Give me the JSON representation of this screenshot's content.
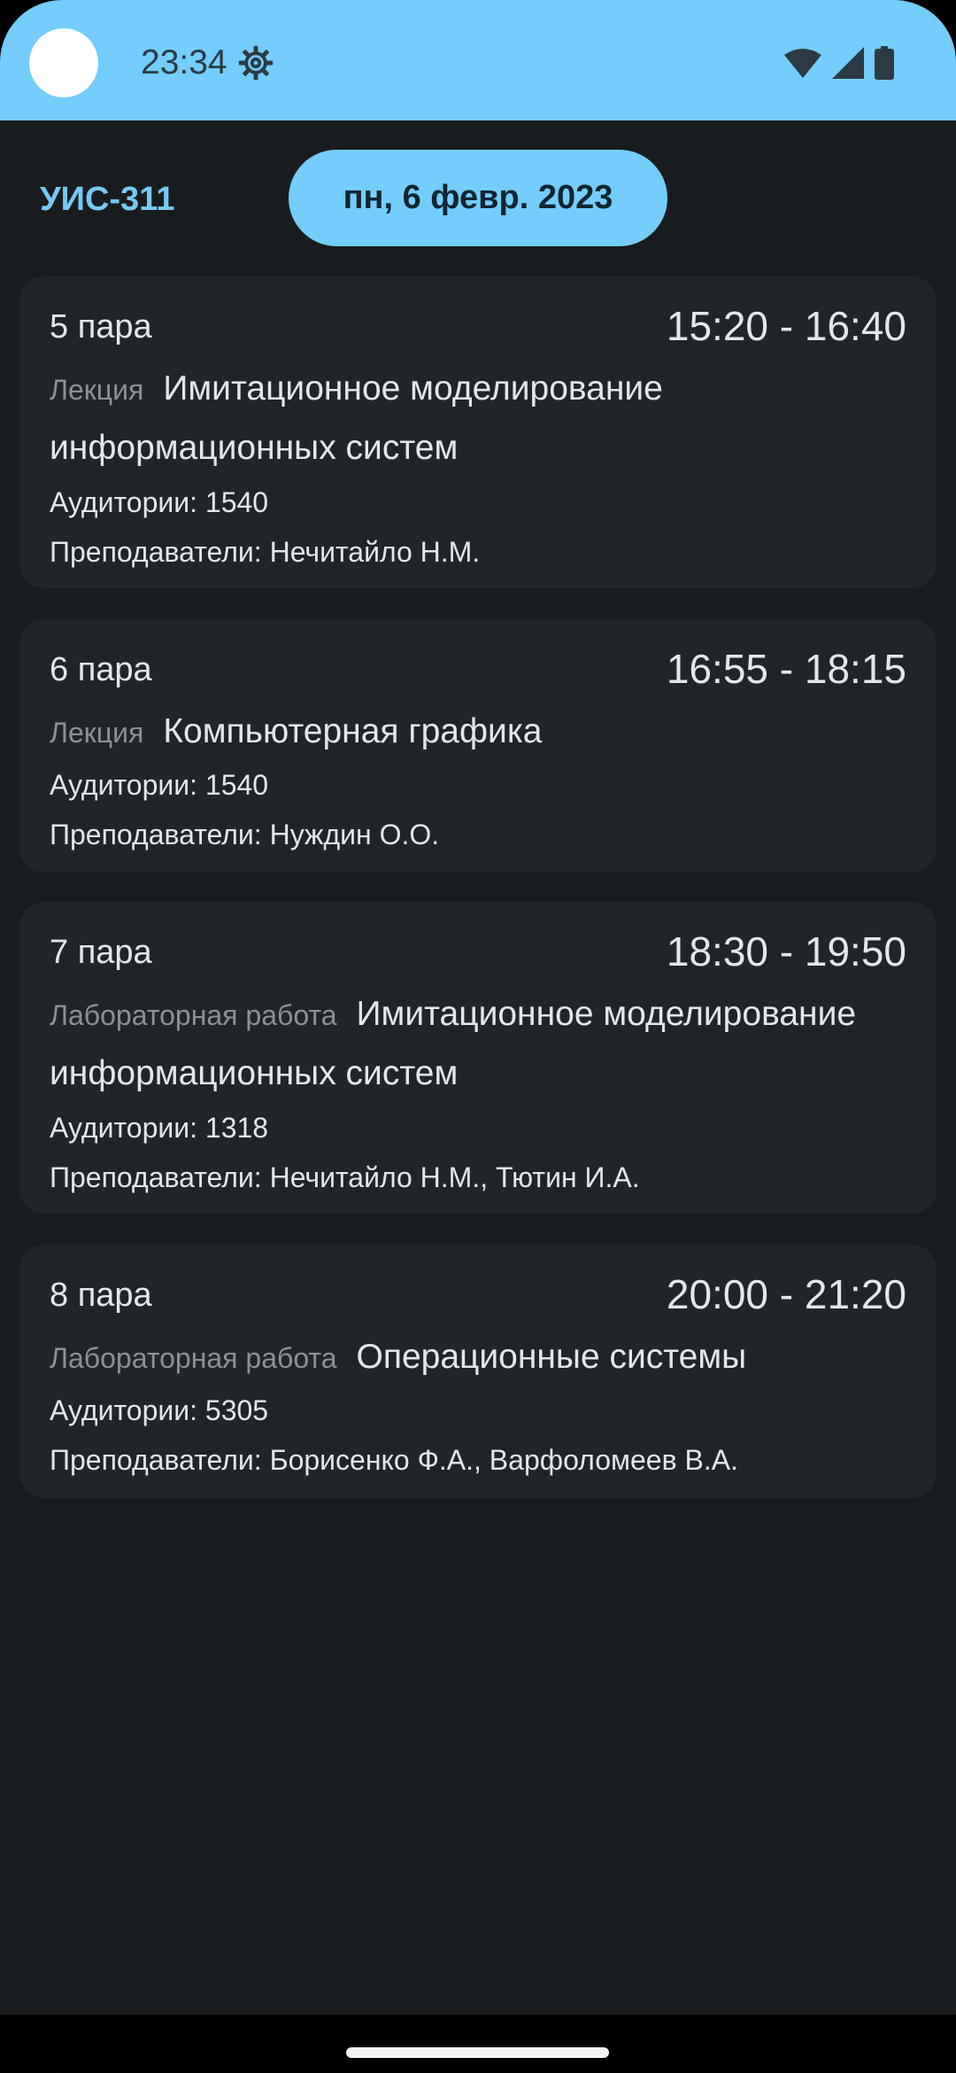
{
  "status_bar": {
    "time": "23:34",
    "icons": [
      "settings-gear-icon",
      "wifi-icon",
      "cellular-signal-icon",
      "battery-icon"
    ],
    "background": "#74cdfc"
  },
  "header": {
    "group": "УИС-311",
    "date": "пн, 6 февр. 2023"
  },
  "lessons": [
    {
      "number": "5 пара",
      "time": "15:20 - 16:40",
      "type": "Лекция",
      "subject": "Имитационное моделирование информационных систем",
      "rooms": "Аудитории: 1540",
      "teachers": "Преподаватели: Нечитайло Н.М."
    },
    {
      "number": "6 пара",
      "time": "16:55 - 18:15",
      "type": "Лекция",
      "subject": "Компьютерная графика",
      "rooms": "Аудитории: 1540",
      "teachers": "Преподаватели: Нуждин О.О."
    },
    {
      "number": "7 пара",
      "time": "18:30 - 19:50",
      "type": "Лабораторная работа",
      "subject": "Имитационное моделирование информационных систем",
      "rooms": "Аудитории: 1318",
      "teachers": "Преподаватели: Нечитайло Н.М., Тютин И.А."
    },
    {
      "number": "8 пара",
      "time": "20:00 - 21:20",
      "type": "Лабораторная работа",
      "subject": "Операционные системы",
      "rooms": "Аудитории: 5305",
      "teachers": "Преподаватели: Борисенко Ф.А., Варфоломеев В.А."
    }
  ],
  "colors": {
    "accent": "#74cdfc",
    "background": "#191c1f",
    "card": "#202529",
    "muted_text": "#8b9196"
  }
}
